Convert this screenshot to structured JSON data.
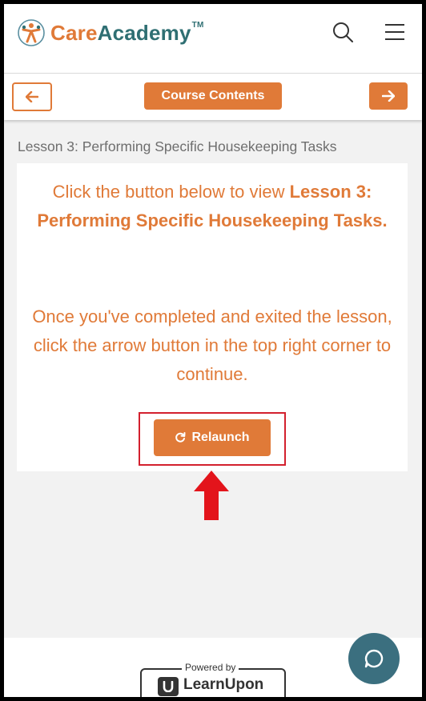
{
  "header": {
    "logo_care": "Care",
    "logo_academy": "Academy",
    "logo_tm": "TM"
  },
  "nav": {
    "course_contents_label": "Course Contents"
  },
  "lesson": {
    "title": "Lesson 3: Performing Specific Housekeeping Tasks",
    "instruction_prefix": "Click the button below to view ",
    "instruction_bold": "Lesson 3: Performing Specific Housekeeping Tasks.",
    "continue_text": "Once you've completed and exited the lesson, click the arrow button in the top right corner to continue.",
    "relaunch_label": "Relaunch"
  },
  "footer": {
    "powered_by": "Powered by",
    "brand": "LearnUpon"
  },
  "colors": {
    "accent": "#e07a38",
    "brand_teal": "#2f6f73",
    "highlight_red": "#d3202e",
    "chat_button": "#3b6f7f"
  },
  "icons": [
    "care-academy-logo-icon",
    "search-icon",
    "menu-icon",
    "arrow-left-icon",
    "arrow-right-icon",
    "refresh-icon",
    "red-arrow-annotation-icon",
    "learnupon-logo-icon",
    "chat-icon"
  ]
}
